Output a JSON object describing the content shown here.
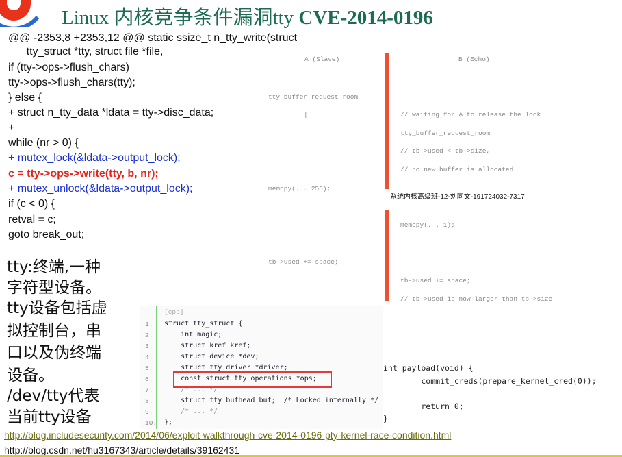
{
  "title": {
    "prefix": "Linux 内核竞争条件漏洞tty ",
    "cve": "CVE-2014-0196"
  },
  "code": [
    {
      "text": "@@ -2353,8 +2353,12 @@ static ssize_t n_tty_write(struct",
      "style": "normal"
    },
    {
      "text": "      tty_struct *tty, struct file *file,",
      "style": "normal"
    },
    {
      "text": "if (tty->ops->flush_chars)",
      "style": "normal"
    },
    {
      "text": "tty->ops->flush_chars(tty);",
      "style": "normal"
    },
    {
      "text": "} else {",
      "style": "normal"
    },
    {
      "text": "+ struct n_tty_data *ldata = tty->disc_data;",
      "style": "normal"
    },
    {
      "text": "+",
      "style": "normal"
    },
    {
      "text": "while (nr > 0) {",
      "style": "normal"
    },
    {
      "text": "+ mutex_lock(&ldata->output_lock);",
      "style": "blue"
    },
    {
      "text": "c = tty->ops->write(tty, b, nr);",
      "style": "red"
    },
    {
      "text": "+ mutex_unlock(&ldata->output_lock);",
      "style": "blue"
    },
    {
      "text": "if (c < 0) {",
      "style": "normal"
    },
    {
      "text": "retval = c;",
      "style": "normal"
    },
    {
      "text": "goto break_out;",
      "style": "normal"
    }
  ],
  "description": [
    "tty:终端,一种",
    "字符型设备。",
    "tty设备包括虚",
    "拟控制台，串",
    "口以及伪终端",
    "设备。",
    "/dev/tty代表",
    "当前tty设备"
  ],
  "diagram": {
    "col_a": "A (Slave)",
    "col_b": "B (Echo)",
    "a_lines": [
      "tty_buffer_request_room",
      "|",
      "memcpy(. . 256);",
      "tb->used += space;"
    ],
    "b_lines": [
      "// waiting for A to release the lock",
      "tty_buffer_request_room",
      "// tb->used < tb->size,",
      "// no new buffer is allocated",
      "memcpy(. . 1);",
      "tb->used += space;",
      "// tb->used is now larger than tb->size"
    ]
  },
  "watermark": "系统内核高级班-12-刘同文-191724032-7317",
  "snippet": {
    "lang": "[cpp]",
    "numbers": [
      "1.",
      "2.",
      "3.",
      "4.",
      "5.",
      "6.",
      "7.",
      "8.",
      "9.",
      "10."
    ],
    "lines": [
      "struct tty_struct {",
      "    int magic;",
      "    struct kref kref;",
      "    struct device *dev;",
      "    struct tty_driver *driver;",
      "    const struct tty_operations *ops;",
      "    /* ... */",
      "    struct tty_bufhead buf;  /* Locked internally */",
      "    /* ... */",
      "};"
    ]
  },
  "payload": [
    "int payload(void) {",
    "        commit_creds(prepare_kernel_cred(0));",
    "",
    "        return 0;",
    "}"
  ],
  "links": [
    "http://blog.includesecurity.com/2014/06/exploit-walkthrough-cve-2014-0196-pty-kernel-race-condition.html",
    "http://blog.csdn.net/hu3167343/article/details/39162431"
  ],
  "colors": {
    "title": "#1d6b55",
    "highlight": "#e8231b",
    "lock": "#1a2fd0",
    "bar": "#f05030"
  }
}
